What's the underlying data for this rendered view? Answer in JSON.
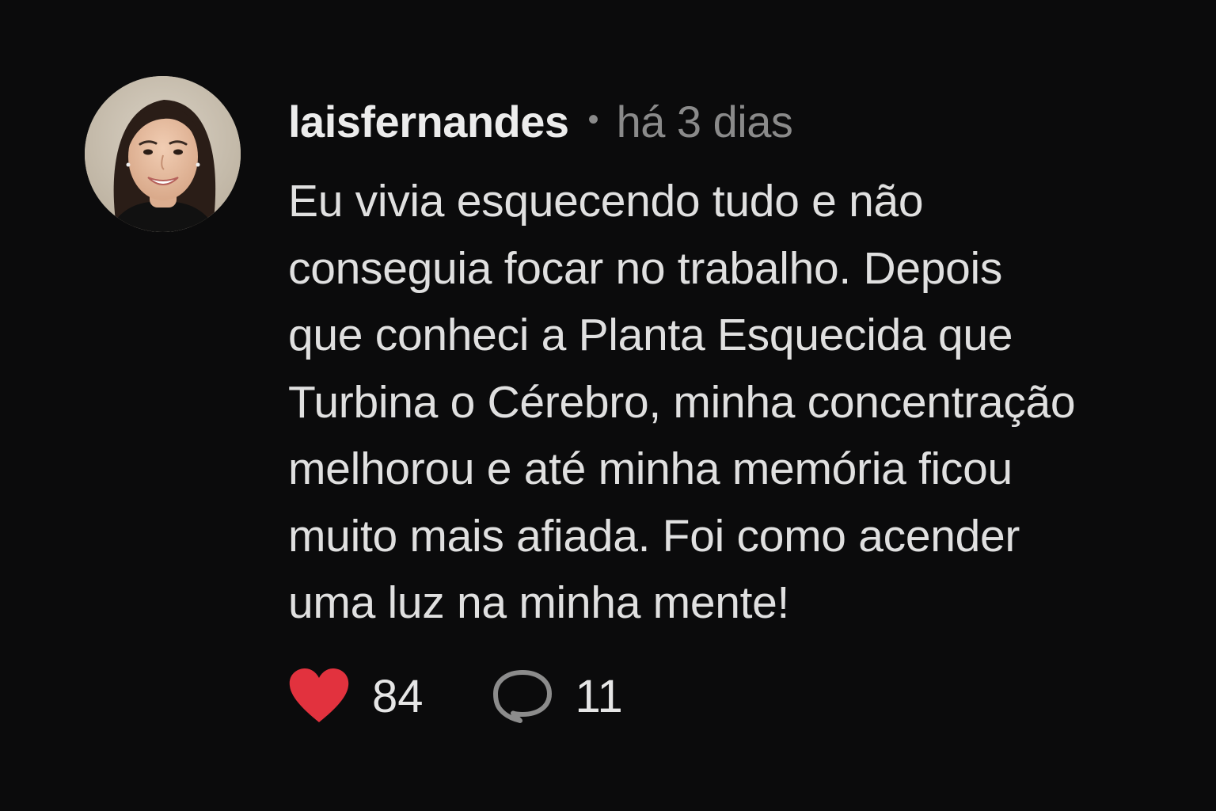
{
  "post": {
    "username": "laisfernandes",
    "separator": "•",
    "timestamp": "há 3 dias",
    "body_lines": [
      "Eu vivia esquecendo tudo e não",
      "conseguia focar no trabalho. Depois",
      "que conheci a Planta Esquecida que",
      "Turbina o Cérebro, minha concentração",
      "melhorou e até minha memória ficou",
      "muito mais afiada. Foi como acender",
      "uma luz na minha mente!"
    ]
  },
  "actions": {
    "likes": {
      "icon": "heart-icon",
      "count": "84",
      "color": "#e2323e"
    },
    "comments": {
      "icon": "speech-bubble-icon",
      "count": "11",
      "color": "#8c8c8c"
    }
  },
  "colors": {
    "background": "#0b0b0c",
    "username": "#ececec",
    "meta": "#8a8a8a",
    "body": "#e0e0e0"
  }
}
